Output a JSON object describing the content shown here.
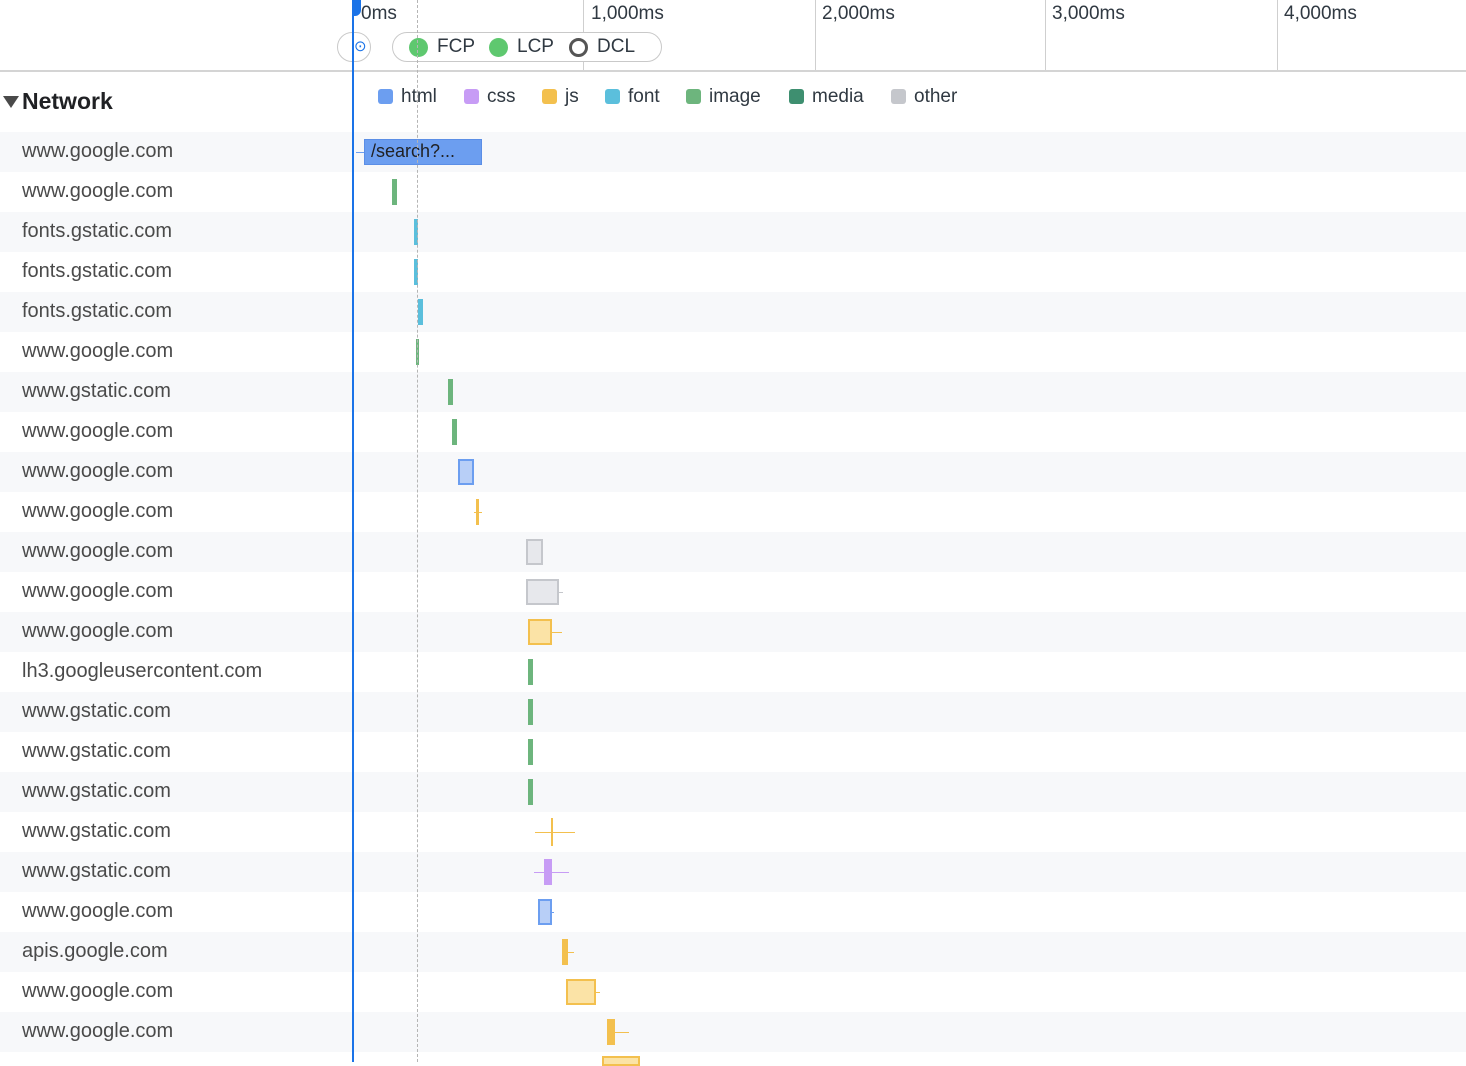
{
  "ruler": {
    "ticks": [
      "0ms",
      "1,000ms",
      "2,000ms",
      "3,000ms",
      "4,000ms"
    ],
    "markers": [
      {
        "label": "FCP",
        "style": "filled",
        "color": "#5ec86f"
      },
      {
        "label": "LCP",
        "style": "filled",
        "color": "#5ec86f"
      },
      {
        "label": "DCL",
        "style": "ring",
        "color": "#555555"
      }
    ]
  },
  "track": {
    "title": "Network",
    "expanded": true
  },
  "legend": [
    {
      "label": "html",
      "color": "#6c9ef0"
    },
    {
      "label": "css",
      "color": "#c79cf5"
    },
    {
      "label": "js",
      "color": "#f3c04e"
    },
    {
      "label": "font",
      "color": "#5bbfdc"
    },
    {
      "label": "image",
      "color": "#6db57d"
    },
    {
      "label": "media",
      "color": "#3e8f70"
    },
    {
      "label": "other",
      "color": "#c5c7cc"
    }
  ],
  "requests": [
    {
      "domain": "www.google.com",
      "type": "html",
      "label": "/search?..."
    },
    {
      "domain": "www.google.com",
      "type": "image"
    },
    {
      "domain": "fonts.gstatic.com",
      "type": "font"
    },
    {
      "domain": "fonts.gstatic.com",
      "type": "font"
    },
    {
      "domain": "fonts.gstatic.com",
      "type": "font"
    },
    {
      "domain": "www.google.com",
      "type": "image"
    },
    {
      "domain": "www.gstatic.com",
      "type": "image"
    },
    {
      "domain": "www.google.com",
      "type": "image"
    },
    {
      "domain": "www.google.com",
      "type": "html"
    },
    {
      "domain": "www.google.com",
      "type": "js"
    },
    {
      "domain": "www.google.com",
      "type": "other"
    },
    {
      "domain": "www.google.com",
      "type": "other"
    },
    {
      "domain": "www.google.com",
      "type": "js"
    },
    {
      "domain": "lh3.googleusercontent.com",
      "type": "image"
    },
    {
      "domain": "www.gstatic.com",
      "type": "image"
    },
    {
      "domain": "www.gstatic.com",
      "type": "image"
    },
    {
      "domain": "www.gstatic.com",
      "type": "image"
    },
    {
      "domain": "www.gstatic.com",
      "type": "js"
    },
    {
      "domain": "www.gstatic.com",
      "type": "css"
    },
    {
      "domain": "www.google.com",
      "type": "html"
    },
    {
      "domain": "apis.google.com",
      "type": "js"
    },
    {
      "domain": "www.google.com",
      "type": "js"
    },
    {
      "domain": "www.google.com",
      "type": "js"
    }
  ]
}
